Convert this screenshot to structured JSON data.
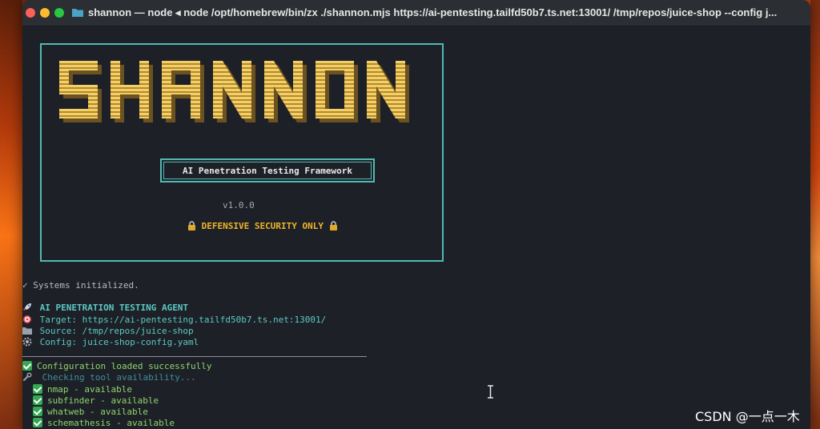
{
  "window": {
    "title": "shannon — node ◂ node /opt/homebrew/bin/zx ./shannon.mjs https://ai-pentesting.tailfd50b7.ts.net:13001/ /tmp/repos/juice-shop --config j..."
  },
  "banner": {
    "logo_text": "SHANNON",
    "subtitle": "AI Penetration Testing Framework",
    "version": "v1.0.0",
    "notice": "DEFENSIVE SECURITY ONLY"
  },
  "log": {
    "systems": "✓ Systems initialized.",
    "agent_title": "AI PENETRATION TESTING AGENT",
    "target": "Target: https://ai-pentesting.tailfd50b7.ts.net:13001/",
    "source": "Source: /tmp/repos/juice-shop",
    "config": "Config: juice-shop-config.yaml",
    "config_loaded": "Configuration loaded successfully",
    "checking": "Checking tool availability...",
    "tools": [
      "nmap - available",
      "subfinder - available",
      "whatweb - available",
      "schemathesis - available"
    ]
  },
  "watermark": "CSDN @一点一木",
  "colors": {
    "accent_cyan": "#52b9b2",
    "logo_yellow": "#f3cf6a",
    "warning_gold": "#f0b429",
    "success_green": "#35a853"
  },
  "icons": [
    "folder-icon",
    "lock-icon",
    "rocket-icon",
    "target-icon",
    "source-folder-icon",
    "gear-icon",
    "check-icon",
    "wrench-icon",
    "text-cursor-icon"
  ]
}
